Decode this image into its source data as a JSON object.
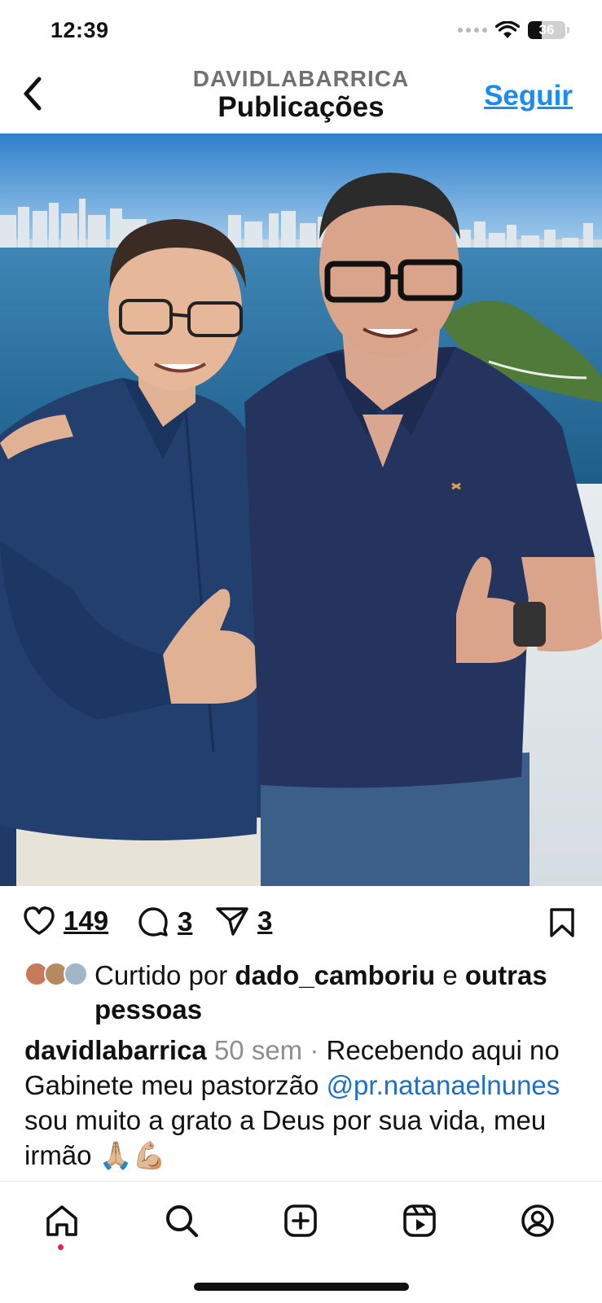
{
  "status_bar": {
    "time": "12:39",
    "battery_level": "36",
    "battery_fraction": 0.36,
    "icons": [
      "signal-dots-icon",
      "wifi-icon",
      "battery-icon"
    ]
  },
  "header": {
    "username": "DAVIDLABARRICA",
    "title": "Publicações",
    "follow_label": "Seguir",
    "back_icon": "chevron-left-icon"
  },
  "post": {
    "image_description_icon": "photo",
    "actions": {
      "likes_count": "149",
      "comments_count": "3",
      "shares_count": "3"
    },
    "liked_by": {
      "prefix": "Curtido por",
      "user": "dado_camboriu",
      "connector": "e",
      "others": "outras pessoas"
    },
    "caption": {
      "author": "davidlabarrica",
      "time": "50 sem",
      "separator": "·",
      "text_part1": "Recebendo aqui no Gabinete meu pastorzão",
      "mention": "@pr.natanaelnunes",
      "text_part2": "sou muito a grato a Deus por sua vida, meu irmão 🙏🏼💪🏼"
    }
  },
  "tab_bar": {
    "tabs": [
      "home-icon",
      "search-icon",
      "create-icon",
      "reels-icon",
      "profile-icon"
    ]
  },
  "colors": {
    "accent_blue": "#1a8cf0",
    "mention_blue": "#1e6fc8",
    "notification_red": "#ee1d4f",
    "muted_gray": "#8e8e8e"
  }
}
